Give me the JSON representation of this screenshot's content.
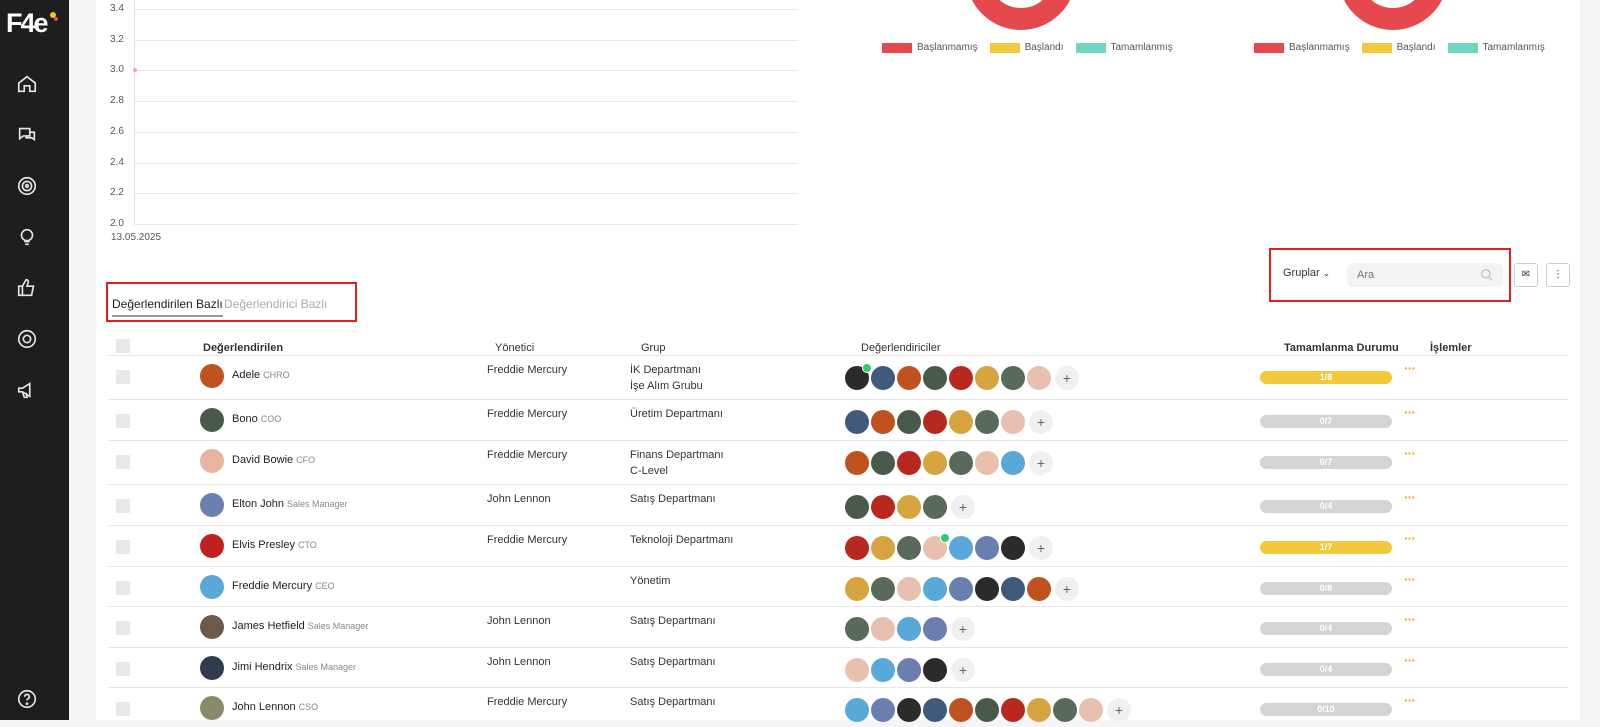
{
  "app": {
    "logo": "F4e"
  },
  "nav": {
    "icons": [
      "home-icon",
      "chat-icon",
      "target-icon",
      "lightbulb-icon",
      "thumbs-up-icon",
      "settings-ring-icon",
      "megaphone-icon",
      "help-icon"
    ]
  },
  "chart_data": {
    "type": "line",
    "x": [
      "13.05.2025"
    ],
    "series": [
      {
        "values": [
          3.0
        ]
      }
    ],
    "ylim": [
      2.0,
      3.4
    ],
    "yticks": [
      "3.4",
      "3.2",
      "3.0",
      "2.8",
      "2.6",
      "2.4",
      "2.2",
      "2.0"
    ],
    "xlabel": "",
    "ylabel": "",
    "grid": true
  },
  "legends": [
    {
      "items": [
        "Başlanmamış",
        "Başlandı",
        "Tamamlanmış"
      ]
    },
    {
      "items": [
        "Başlanmamış",
        "Başlandı",
        "Tamamlanmış"
      ]
    }
  ],
  "colors": {
    "not_started": "#e5484d",
    "started": "#f1c93b",
    "completed": "#6fd6c4",
    "accent": "#f5a623"
  },
  "tabs": {
    "active": "Değerlendirilen Bazlı",
    "inactive": "Değerlendirici Bazlı"
  },
  "filters": {
    "groups_label": "Gruplar",
    "search_placeholder": "Ara"
  },
  "table": {
    "headers": {
      "evaluated": "Değerlendirilen",
      "manager": "Yönetici",
      "group": "Grup",
      "evaluators": "Değerlendiriciler",
      "status": "Tamamlanma Durumu",
      "actions": "İşlemler"
    },
    "rows": [
      {
        "name": "Adele",
        "title": "CHRO",
        "manager": "Freddie Mercury",
        "groups": [
          "İK Departmanı",
          "İşe Alım Grubu"
        ],
        "evaluators": 8,
        "checked": [
          0
        ],
        "progress": "1/8",
        "partial": true,
        "avatar": "#c0521f"
      },
      {
        "name": "Bono",
        "title": "COO",
        "manager": "Freddie Mercury",
        "groups": [
          "Üretim Departmanı"
        ],
        "evaluators": 7,
        "checked": [],
        "progress": "0/7",
        "partial": false,
        "avatar": "#4a5a4a"
      },
      {
        "name": "David Bowie",
        "title": "CFO",
        "manager": "Freddie Mercury",
        "groups": [
          "Finans Departmanı",
          "C-Level"
        ],
        "evaluators": 7,
        "checked": [],
        "progress": "0/7",
        "partial": false,
        "avatar": "#e8b4a0"
      },
      {
        "name": "Elton John",
        "title": "Sales Manager",
        "manager": "John Lennon",
        "groups": [
          "Satış Departmanı"
        ],
        "evaluators": 4,
        "checked": [],
        "progress": "0/4",
        "partial": false,
        "avatar": "#6a7fb0"
      },
      {
        "name": "Elvis Presley",
        "title": "CTO",
        "manager": "Freddie Mercury",
        "groups": [
          "Teknoloji Departmanı"
        ],
        "evaluators": 7,
        "checked": [
          3
        ],
        "progress": "1/7",
        "partial": true,
        "avatar": "#c0201f"
      },
      {
        "name": "Freddie Mercury",
        "title": "CEO",
        "manager": "",
        "groups": [
          "Yönetim"
        ],
        "evaluators": 8,
        "checked": [],
        "progress": "0/8",
        "partial": false,
        "avatar": "#5aa8d8"
      },
      {
        "name": "James Hetfield",
        "title": "Sales Manager",
        "manager": "John Lennon",
        "groups": [
          "Satış Departmanı"
        ],
        "evaluators": 4,
        "checked": [],
        "progress": "0/4",
        "partial": false,
        "avatar": "#6b5a4a"
      },
      {
        "name": "Jimi Hendrix",
        "title": "Sales Manager",
        "manager": "John Lennon",
        "groups": [
          "Satış Departmanı"
        ],
        "evaluators": 4,
        "checked": [],
        "progress": "0/4",
        "partial": false,
        "avatar": "#2f3b4a"
      },
      {
        "name": "John Lennon",
        "title": "CSO",
        "manager": "Freddie Mercury",
        "groups": [
          "Satış Departmanı"
        ],
        "evaluators": 10,
        "checked": [],
        "progress": "0/10",
        "partial": false,
        "avatar": "#8a8a6a"
      }
    ]
  }
}
